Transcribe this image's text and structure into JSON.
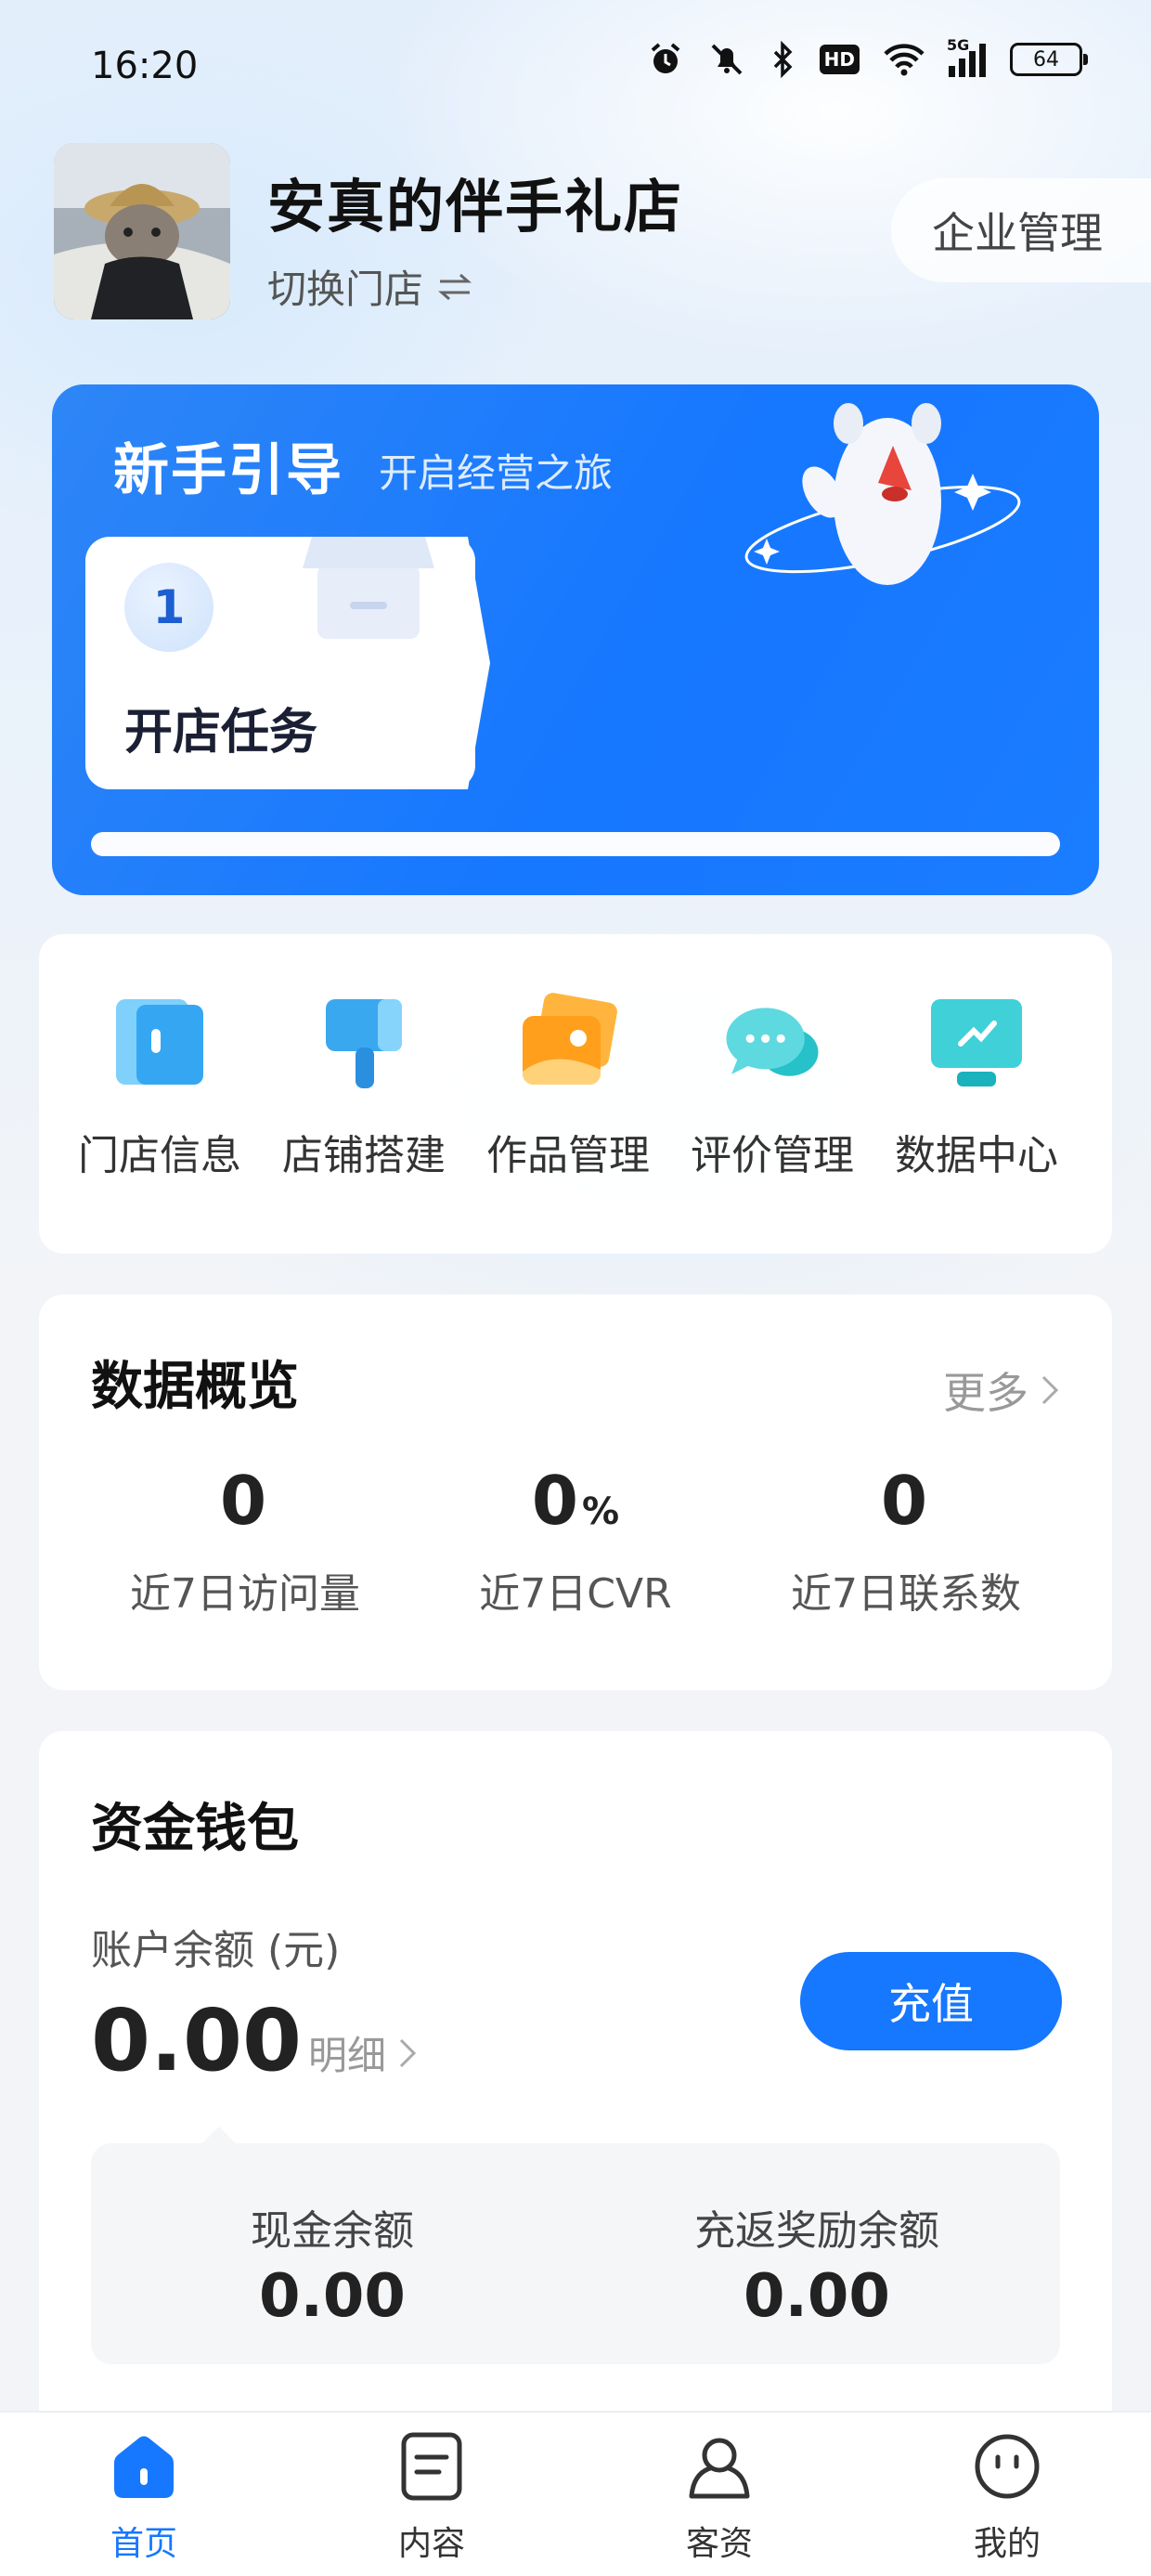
{
  "status_bar": {
    "time": "16:20",
    "hd_label": "HD",
    "signal_label": "5G",
    "battery": "64",
    "icons": [
      "alarm-icon",
      "mute-icon",
      "bluetooth-icon",
      "hd-icon",
      "wifi-icon",
      "signal-icon",
      "battery-icon"
    ]
  },
  "header": {
    "shop_name": "安真的伴手礼店",
    "switch_label": "切换门店",
    "enterprise_button": "企业管理"
  },
  "guide": {
    "title": "新手引导",
    "subtitle": "开启经营之旅",
    "task_number": "1",
    "task_label": "开店任务",
    "progress": 1.0
  },
  "quick_menu": [
    {
      "label": "门店信息",
      "icon": "store-info-icon"
    },
    {
      "label": "店铺搭建",
      "icon": "paint-brush-icon"
    },
    {
      "label": "作品管理",
      "icon": "photo-cards-icon"
    },
    {
      "label": "评价管理",
      "icon": "chat-bubbles-icon"
    },
    {
      "label": "数据中心",
      "icon": "monitor-chart-icon"
    }
  ],
  "data_overview": {
    "title": "数据概览",
    "more": "更多",
    "stats": [
      {
        "value": "0",
        "unit": "",
        "label": "近7日访问量"
      },
      {
        "value": "0",
        "unit": "%",
        "label": "近7日CVR"
      },
      {
        "value": "0",
        "unit": "",
        "label": "近7日联系数"
      }
    ]
  },
  "wallet": {
    "title": "资金钱包",
    "balance_label": "账户余额 (元)",
    "balance": "0.00",
    "detail": "明细",
    "recharge": "充值",
    "cash_label": "现金余额",
    "cash_value": "0.00",
    "reward_label": "充返奖励余额",
    "reward_value": "0.00"
  },
  "tabbar": [
    {
      "label": "首页",
      "icon": "home-icon",
      "active": true
    },
    {
      "label": "内容",
      "icon": "document-icon",
      "active": false
    },
    {
      "label": "客资",
      "icon": "customer-icon",
      "active": false
    },
    {
      "label": "我的",
      "icon": "profile-face-icon",
      "active": false
    }
  ],
  "colors": {
    "accent": "#1677ff",
    "guide_bg": "#1677ff"
  }
}
